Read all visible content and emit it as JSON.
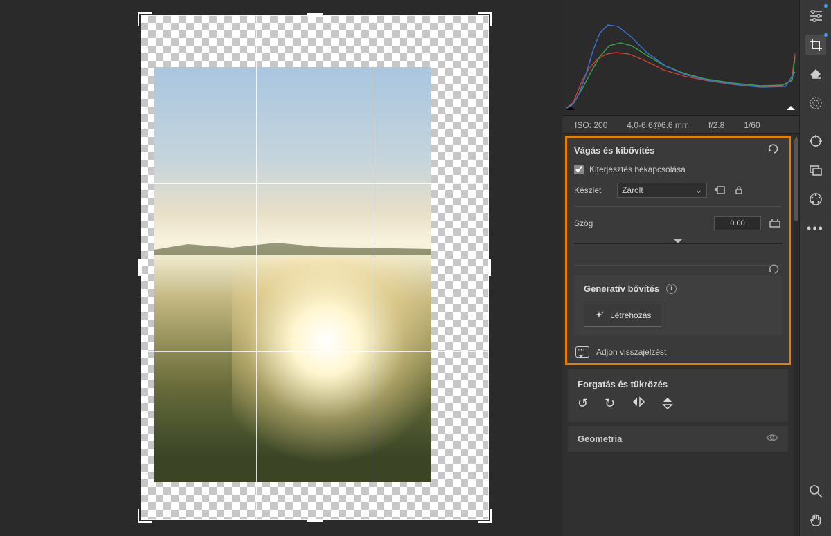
{
  "exif": {
    "iso": "ISO: 200",
    "focal": "4.0-6.6@6.6 mm",
    "aperture": "f/2.8",
    "shutter": "1/60"
  },
  "panel": {
    "title": "Vágás és kibővítés",
    "extension_checkbox": "Kiterjesztés bekapcsolása",
    "preset_label": "Készlet",
    "preset_value": "Zárolt",
    "angle_label": "Szög",
    "angle_value": "0.00"
  },
  "gen": {
    "title": "Generatív bővítés",
    "create_button": "Létrehozás",
    "feedback": "Adjon visszajelzést"
  },
  "rotate_panel": {
    "title": "Forgatás és tükrözés"
  },
  "geometry_panel": {
    "title": "Geometria"
  }
}
